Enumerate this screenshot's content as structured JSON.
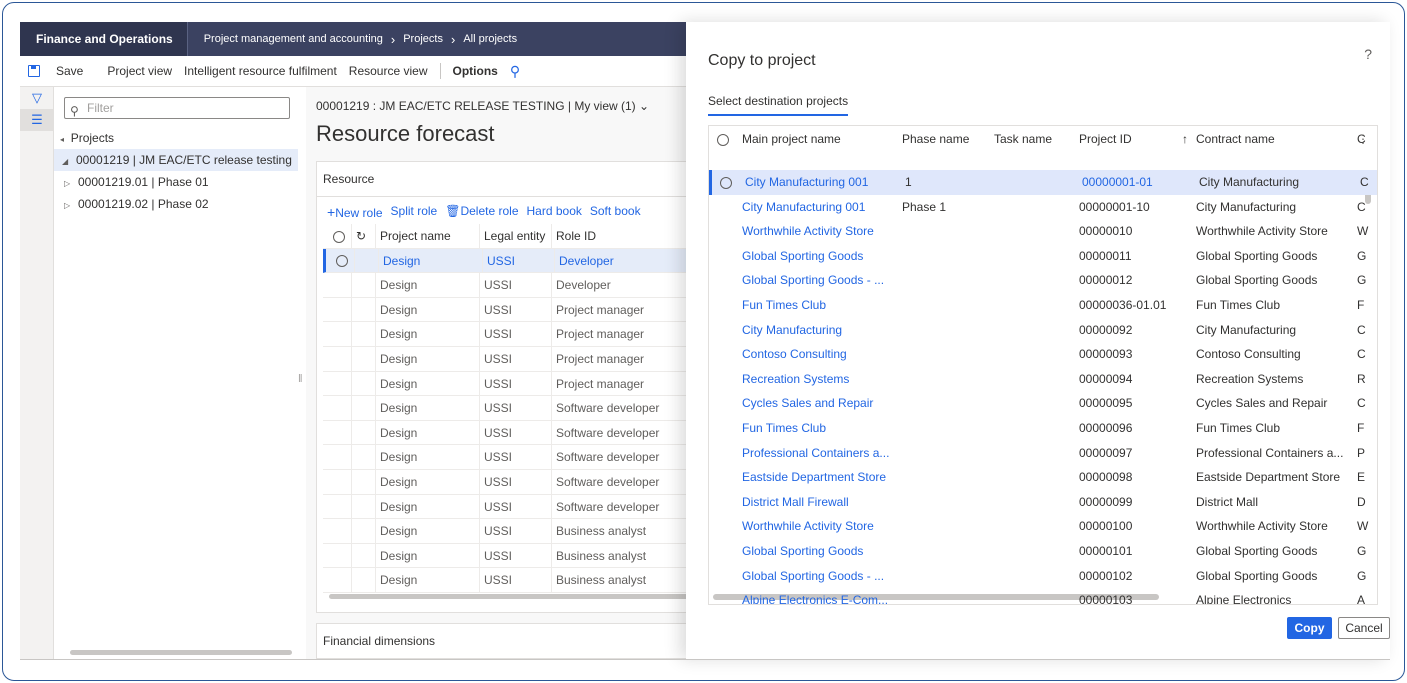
{
  "navbar": {
    "app_name": "Finance and Operations",
    "crumb1": "Project management and accounting",
    "crumb2": "Projects",
    "crumb3": "All projects"
  },
  "actions": {
    "save": "Save",
    "project_view": "Project view",
    "irf": "Intelligent resource fulfilment",
    "resource_view": "Resource view",
    "options": "Options"
  },
  "tree": {
    "filter_placeholder": "Filter",
    "root": "Projects",
    "items": [
      "00001219 | JM EAC/ETC release testing",
      "00001219.01 | Phase 01",
      "00001219.02 | Phase 02"
    ]
  },
  "content": {
    "record_line": "00001219 : JM EAC/ETC RELEASE TESTING  |  My view (1)",
    "title": "Resource forecast",
    "section": "Resource",
    "res_actions": [
      "New role",
      "Split role",
      "Delete role",
      "Hard book",
      "Soft book"
    ],
    "columns": [
      "Project name",
      "Legal entity",
      "Role ID"
    ],
    "rows": [
      [
        "Design",
        "USSI",
        "Developer"
      ],
      [
        "Design",
        "USSI",
        "Developer"
      ],
      [
        "Design",
        "USSI",
        "Project manager"
      ],
      [
        "Design",
        "USSI",
        "Project manager"
      ],
      [
        "Design",
        "USSI",
        "Project manager"
      ],
      [
        "Design",
        "USSI",
        "Project manager"
      ],
      [
        "Design",
        "USSI",
        "Software developer"
      ],
      [
        "Design",
        "USSI",
        "Software developer"
      ],
      [
        "Design",
        "USSI",
        "Software developer"
      ],
      [
        "Design",
        "USSI",
        "Software developer"
      ],
      [
        "Design",
        "USSI",
        "Software developer"
      ],
      [
        "Design",
        "USSI",
        "Business analyst"
      ],
      [
        "Design",
        "USSI",
        "Business analyst"
      ],
      [
        "Design",
        "USSI",
        "Business analyst"
      ]
    ],
    "financial_dimensions": "Financial dimensions"
  },
  "dialog": {
    "help": "?",
    "title": "Copy to project",
    "tab": "Select destination projects",
    "columns": {
      "main_project_name": "Main project name",
      "phase_name": "Phase name",
      "task_name": "Task name",
      "project_id": "Project ID",
      "sort_indicator": "↑",
      "contract_name": "Contract name",
      "c_trunc": "C"
    },
    "rows": [
      {
        "name": "City Manufacturing 001",
        "phase": "1",
        "id": "00000001-01",
        "contract": "City Manufacturing",
        "c": "C"
      },
      {
        "name": "City Manufacturing 001",
        "phase": "Phase 1",
        "id": "00000001-10",
        "contract": "City Manufacturing",
        "c": "C"
      },
      {
        "name": "Worthwhile Activity Store",
        "phase": "",
        "id": "00000010",
        "contract": "Worthwhile Activity Store",
        "c": "W"
      },
      {
        "name": "Global Sporting Goods",
        "phase": "",
        "id": "00000011",
        "contract": "Global Sporting Goods",
        "c": "G"
      },
      {
        "name": "Global Sporting Goods - ...",
        "phase": "",
        "id": "00000012",
        "contract": "Global Sporting Goods",
        "c": "G"
      },
      {
        "name": "Fun Times Club",
        "phase": "",
        "id": "00000036-01.01",
        "contract": "Fun Times Club",
        "c": "F"
      },
      {
        "name": "City Manufacturing",
        "phase": "",
        "id": "00000092",
        "contract": "City Manufacturing",
        "c": "C"
      },
      {
        "name": "Contoso Consulting",
        "phase": "",
        "id": "00000093",
        "contract": "Contoso Consulting",
        "c": "C"
      },
      {
        "name": "Recreation Systems",
        "phase": "",
        "id": "00000094",
        "contract": "Recreation Systems",
        "c": "R"
      },
      {
        "name": "Cycles Sales and Repair",
        "phase": "",
        "id": "00000095",
        "contract": "Cycles Sales and Repair",
        "c": "C"
      },
      {
        "name": "Fun Times Club",
        "phase": "",
        "id": "00000096",
        "contract": "Fun Times Club",
        "c": "F"
      },
      {
        "name": "Professional Containers a...",
        "phase": "",
        "id": "00000097",
        "contract": "Professional Containers a...",
        "c": "P"
      },
      {
        "name": "Eastside Department Store",
        "phase": "",
        "id": "00000098",
        "contract": "Eastside Department Store",
        "c": "E"
      },
      {
        "name": "District Mall Firewall",
        "phase": "",
        "id": "00000099",
        "contract": "District Mall",
        "c": "D"
      },
      {
        "name": "Worthwhile Activity Store",
        "phase": "",
        "id": "00000100",
        "contract": "Worthwhile Activity Store",
        "c": "W"
      },
      {
        "name": "Global Sporting Goods",
        "phase": "",
        "id": "00000101",
        "contract": "Global Sporting Goods",
        "c": "G"
      },
      {
        "name": "Global Sporting Goods - ...",
        "phase": "",
        "id": "00000102",
        "contract": "Global Sporting Goods",
        "c": "G"
      },
      {
        "name": "Alpine Electronics E-Com...",
        "phase": "",
        "id": "00000103",
        "contract": "Alpine Electronics",
        "c": "A"
      }
    ],
    "copy_label": "Copy",
    "cancel_label": "Cancel"
  },
  "colors": {
    "accent": "#2266e3",
    "navbar": "#3b4261",
    "selected_row": "#dfe7fb"
  }
}
